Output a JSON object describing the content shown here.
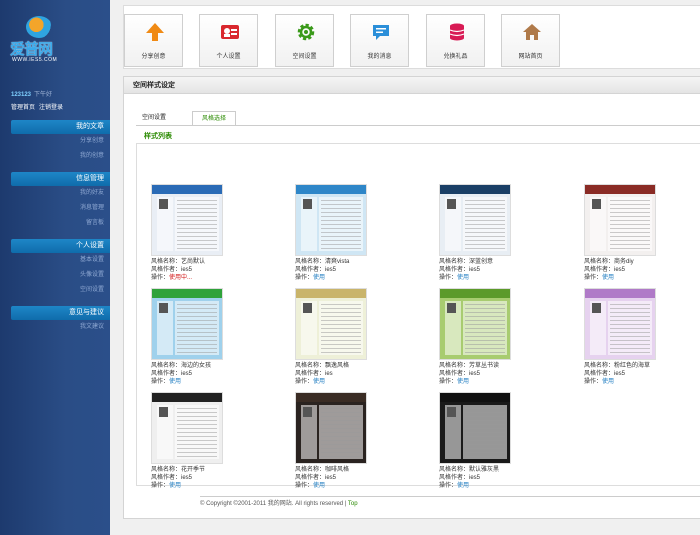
{
  "logo": {
    "text": "爱普网",
    "domain": "WWW.IES5.COM"
  },
  "user": {
    "id": "123123",
    "greeting": "下午好"
  },
  "user_links": [
    "管理首页",
    "注销登录"
  ],
  "sidebar": [
    {
      "head": "我的文章",
      "items": [
        "分享创意",
        "我的创意"
      ]
    },
    {
      "head": "信息管理",
      "items": [
        "我的好友",
        "消息管理",
        "留言板"
      ]
    },
    {
      "head": "个人设置",
      "items": [
        "基本设置",
        "头像设置",
        "空间设置"
      ]
    },
    {
      "head": "意见与建议",
      "items": [
        "我文建议"
      ]
    }
  ],
  "nav": [
    {
      "label": "分享创意",
      "icon": "upload-arrow-icon",
      "color": "#f08a14"
    },
    {
      "label": "个人设置",
      "icon": "profile-card-icon",
      "color": "#d9272e"
    },
    {
      "label": "空间设置",
      "icon": "gear-icon",
      "color": "#3a9a1a"
    },
    {
      "label": "我的消息",
      "icon": "chat-bubble-icon",
      "color": "#2b8fd9"
    },
    {
      "label": "兑换礼品",
      "icon": "database-icon",
      "color": "#d81b55"
    },
    {
      "label": "网站首页",
      "icon": "home-icon",
      "color": "#b07a4a"
    }
  ],
  "panel": {
    "title": "空间样式设定",
    "tab1": "空间设置",
    "tab2": "风格选择",
    "list_title": "样式列表"
  },
  "themes": [
    {
      "name": "风格名称：艺尚默认",
      "author": "风格作者：ies5",
      "action": "操作：",
      "action_label": "使用中...",
      "current": true,
      "colors": [
        "#2a6bb6",
        "#e9eef5"
      ]
    },
    {
      "name": "风格名称：清爽vista",
      "author": "风格作者：ies5",
      "action": "操作：",
      "action_label": "使用",
      "current": false,
      "colors": [
        "#2e86c8",
        "#cfe6f4"
      ]
    },
    {
      "name": "风格名称：深蓝创意",
      "author": "风格作者：ies5",
      "action": "操作：",
      "action_label": "使用",
      "current": false,
      "colors": [
        "#1a3f66",
        "#e8eef4"
      ]
    },
    {
      "name": "风格名称：商务diy",
      "author": "风格作者：ies5",
      "action": "操作：",
      "action_label": "使用",
      "current": false,
      "colors": [
        "#8a2b25",
        "#f3f0ef"
      ]
    },
    {
      "name": "风格名称：海边的女孩",
      "author": "风格作者：ies5",
      "action": "操作：",
      "action_label": "使用",
      "current": false,
      "colors": [
        "#2fa23a",
        "#9fd1ec"
      ]
    },
    {
      "name": "风格名称：飘逸风格",
      "author": "风格作者：ies",
      "action": "操作：",
      "action_label": "使用",
      "current": false,
      "colors": [
        "#c9b46a",
        "#eef0d8"
      ]
    },
    {
      "name": "风格名称：芳草丛书读",
      "author": "风格作者：ies5",
      "action": "操作：",
      "action_label": "使用",
      "current": false,
      "colors": [
        "#5c9a2a",
        "#a8cc70"
      ]
    },
    {
      "name": "风格名称：粉红色的海草",
      "author": "风格作者：ies5",
      "action": "操作：",
      "action_label": "使用",
      "current": false,
      "colors": [
        "#b07ac8",
        "#e6d2ef"
      ]
    },
    {
      "name": "风格名称：花开季节",
      "author": "风格作者：ies5",
      "action": "操作：",
      "action_label": "使用",
      "current": false,
      "colors": [
        "#222222",
        "#efefef"
      ]
    },
    {
      "name": "风格名称：咖啡风格",
      "author": "风格作者：ies5",
      "action": "操作：",
      "action_label": "使用",
      "current": false,
      "colors": [
        "#3a2c24",
        "#2a2320"
      ]
    },
    {
      "name": "风格名称：默认雅灰黑",
      "author": "风格作者：ies5",
      "action": "操作：",
      "action_label": "使用",
      "current": false,
      "colors": [
        "#111111",
        "#1a1a1a"
      ]
    }
  ],
  "footer": {
    "copyright": "© Copyright ©2001-2011 我的网站. All rights reserved | ",
    "top": "Top"
  }
}
